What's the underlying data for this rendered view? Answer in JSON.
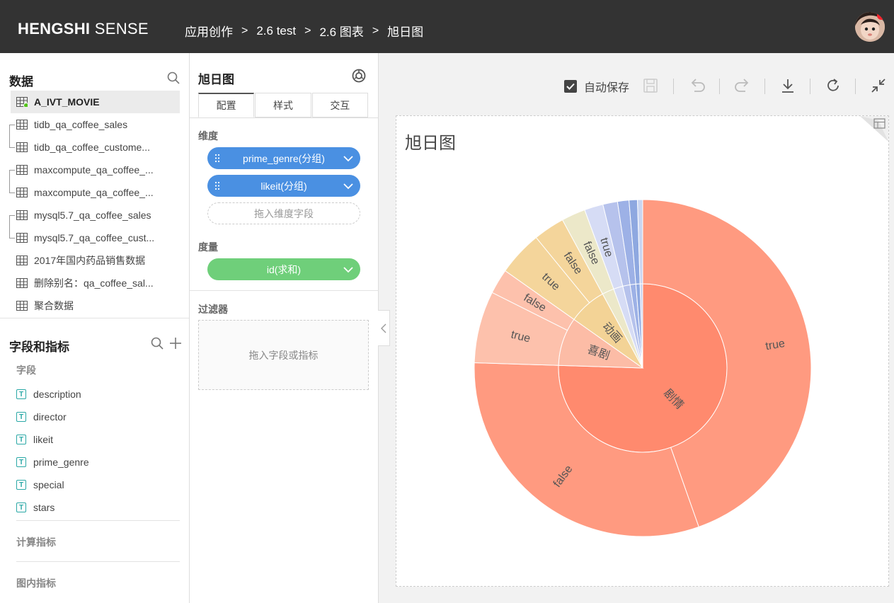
{
  "header": {
    "logo_bold": "HENGSHI",
    "logo_light": "SENSE",
    "breadcrumb": [
      "应用创作",
      "2.6 test",
      "2.6 图表",
      "旭日图"
    ],
    "separator": ">"
  },
  "data_panel": {
    "title": "数据",
    "datasets": [
      "A_IVT_MOVIE",
      "tidb_qa_coffee_sales",
      "tidb_qa_coffee_custome...",
      "maxcompute_qa_coffee_...",
      "maxcompute_qa_coffee_...",
      "mysql5.7_qa_coffee_sales",
      "mysql5.7_qa_coffee_cust...",
      "2017年国内药品销售数据",
      "删除别名：qa_coffee_sal...",
      "聚合数据"
    ]
  },
  "fields_panel": {
    "title": "字段和指标",
    "fields_label": "字段",
    "fields": [
      "description",
      "director",
      "likeit",
      "prime_genre",
      "special",
      "stars"
    ],
    "calc_label": "计算指标",
    "inchart_label": "图内指标",
    "field_type_glyph": "T"
  },
  "config_panel": {
    "title": "旭日图",
    "tabs": [
      "配置",
      "样式",
      "交互"
    ],
    "dimension_label": "维度",
    "dimensions": [
      "prime_genre(分组)",
      "likeit(分组)"
    ],
    "dimension_drop": "拖入维度字段",
    "measure_label": "度量",
    "measures": [
      "id(求和)"
    ],
    "filter_label": "过滤器",
    "filter_drop": "拖入字段或指标"
  },
  "toolbar": {
    "autosave_label": "自动保存",
    "autosave_checked": true
  },
  "colors": {
    "header_bg": "#333333",
    "pill_blue": "#4a90e2",
    "pill_green": "#6fcf7a",
    "field_icon": "#2aa8a6"
  },
  "chart_data": {
    "type": "sunburst",
    "title": "旭日图",
    "inner": [
      {
        "name": "剧情",
        "value": 75.5,
        "color": "#ff8a6e"
      },
      {
        "name": "喜剧",
        "value": 9.3,
        "color": "#fcbca6"
      },
      {
        "name": "动画",
        "value": 7.3,
        "color": "#f3d396"
      },
      {
        "name": "",
        "value": 2.3,
        "color": "#ece8c9"
      },
      {
        "name": "",
        "value": 1.8,
        "color": "#d6dcf5"
      },
      {
        "name": "",
        "value": 1.4,
        "color": "#b6c2ec"
      },
      {
        "name": "",
        "value": 1.1,
        "color": "#9db1e6"
      },
      {
        "name": "",
        "value": 0.8,
        "color": "#8ea8e0"
      },
      {
        "name": "",
        "value": 0.5,
        "color": "#c9d5f1"
      }
    ],
    "outer": [
      {
        "name": "true",
        "parent": "剧情",
        "value": 44.6,
        "color": "#ff9a80"
      },
      {
        "name": "false",
        "parent": "剧情",
        "value": 30.9,
        "color": "#ff9a80"
      },
      {
        "name": "true",
        "parent": "喜剧",
        "value": 6.9,
        "color": "#fdc1ac"
      },
      {
        "name": "false",
        "parent": "喜剧",
        "value": 2.4,
        "color": "#fdc1ac"
      },
      {
        "name": "true",
        "parent": "动画",
        "value": 4.3,
        "color": "#f4d59b"
      },
      {
        "name": "false",
        "parent": "动画",
        "value": 3.0,
        "color": "#f4d59b"
      },
      {
        "name": "false",
        "parent": "",
        "value": 2.3,
        "color": "#ece8c9"
      },
      {
        "name": "true",
        "parent": "",
        "value": 1.8,
        "color": "#d6dcf5"
      },
      {
        "name": "",
        "parent": "",
        "value": 1.4,
        "color": "#b6c2ec"
      },
      {
        "name": "",
        "parent": "",
        "value": 1.1,
        "color": "#9db1e6"
      },
      {
        "name": "",
        "parent": "",
        "value": 0.8,
        "color": "#8ea8e0"
      },
      {
        "name": "",
        "parent": "",
        "value": 0.5,
        "color": "#c9d5f1"
      }
    ]
  }
}
